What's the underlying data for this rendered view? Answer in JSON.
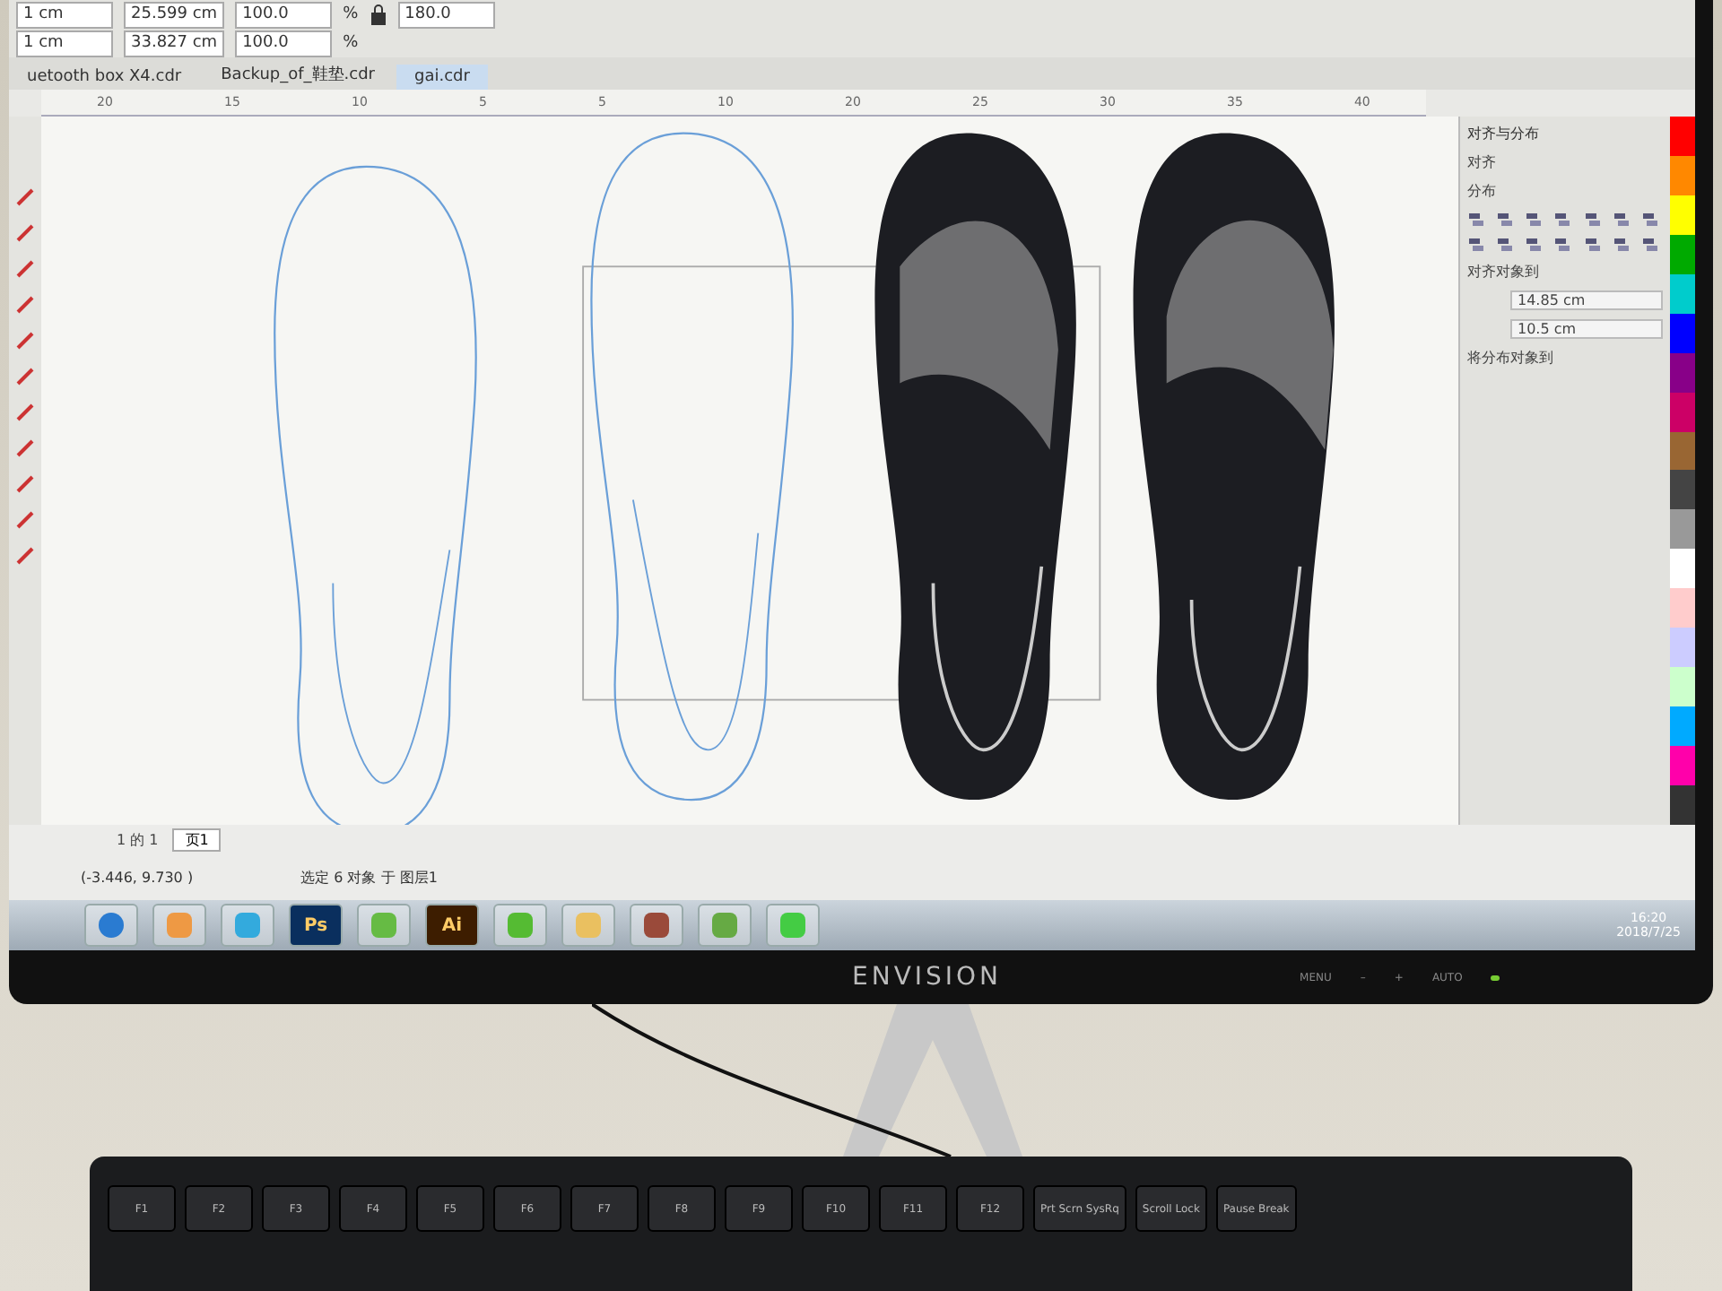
{
  "property_bar": {
    "row_1": [
      {
        "kind": "field",
        "text": "1 cm"
      },
      {
        "kind": "field",
        "text": "25.599 cm"
      },
      {
        "kind": "field",
        "text": "100.0"
      },
      {
        "kind": "unit",
        "text": "%"
      },
      {
        "kind": "lock"
      },
      {
        "kind": "field",
        "text": "180.0"
      }
    ],
    "row_2": [
      {
        "kind": "field",
        "text": "1 cm"
      },
      {
        "kind": "field",
        "text": "33.827 cm"
      },
      {
        "kind": "field",
        "text": "100.0"
      },
      {
        "kind": "unit",
        "text": "%"
      }
    ]
  },
  "document_tabs": [
    {
      "label": "uetooth box X4.cdr",
      "selected": false
    },
    {
      "label": "Backup_of_鞋垫.cdr",
      "selected": false
    },
    {
      "label": "gai.cdr",
      "selected": true
    }
  ],
  "ruler": {
    "labels": [
      "20",
      "15",
      "10",
      "5",
      "5",
      "10",
      "20",
      "25",
      "30",
      "35",
      "40"
    ]
  },
  "docker": {
    "title": "对齐与分布",
    "align_label": "对齐",
    "distribute_label": "分布",
    "align_to_label": "对齐对象到",
    "fields": [
      "14.85 cm",
      "10.5 cm"
    ],
    "distribute_to_label": "将分布对象到"
  },
  "page_nav": {
    "counter": "1 的 1",
    "page_tab": "页1"
  },
  "status_bar": {
    "coordinates": "(-3.446, 9.730 )",
    "selection": "选定 6 对象 于 图层1"
  },
  "taskbar": {
    "apps": [
      {
        "kind": "start"
      },
      {
        "kind": "colors"
      },
      {
        "kind": "ie"
      },
      {
        "kind": "ps",
        "label": "Ps"
      },
      {
        "kind": "tool"
      },
      {
        "kind": "ai",
        "label": "Ai"
      },
      {
        "kind": "browser"
      },
      {
        "kind": "folder"
      },
      {
        "kind": "photo"
      },
      {
        "kind": "editor"
      },
      {
        "kind": "chat"
      }
    ],
    "time": "16:20",
    "date": "2018/7/25"
  },
  "monitor": {
    "brand": "ENVISION",
    "buttons": [
      "MENU",
      "–",
      "+",
      "AUTO"
    ]
  },
  "keyboard": {
    "keys": [
      "F1",
      "F2",
      "F3",
      "F4",
      "F5",
      "F6",
      "F7",
      "F8",
      "F9",
      "F10",
      "F11",
      "F12",
      "Prt Scrn SysRq",
      "Scroll Lock",
      "Pause Break"
    ]
  }
}
